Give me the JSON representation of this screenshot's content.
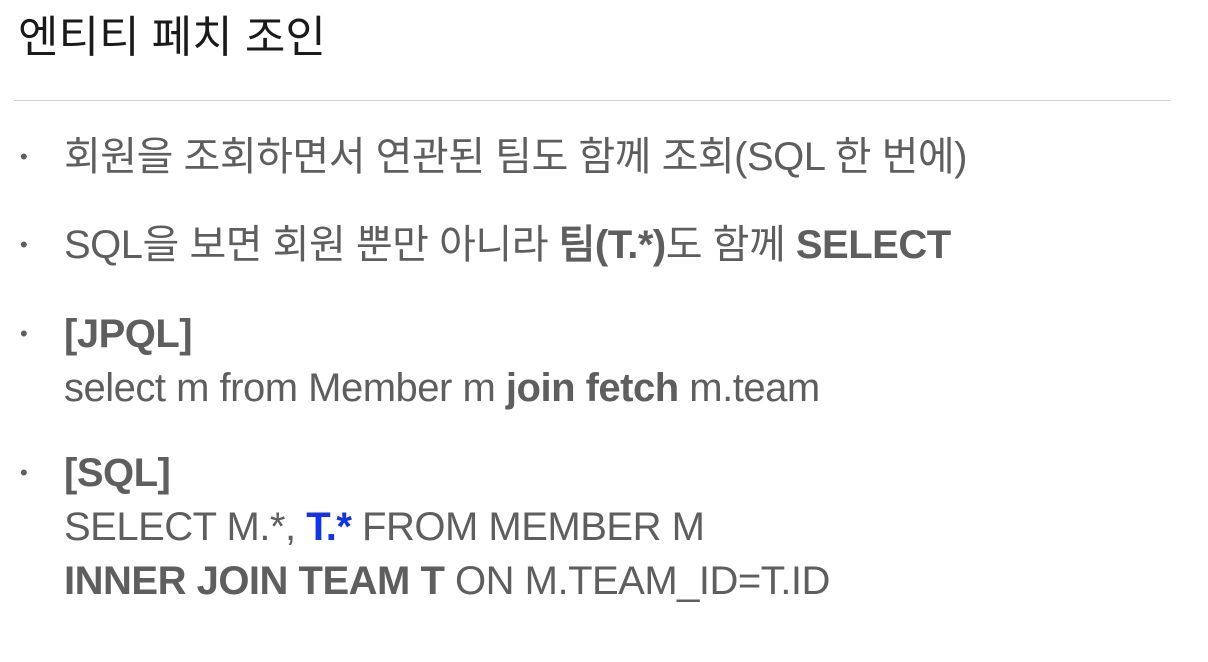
{
  "slide": {
    "title": "엔티티 페치 조인"
  },
  "bullets": {
    "b1": {
      "text": "회원을 조회하면서 연관된 팀도 함께 조회(SQL 한 번에)"
    },
    "b2": {
      "prefix": "SQL을 보면 회원 뿐만 아니라 ",
      "bold1": "팀(T.*)",
      "mid": "도 함께 ",
      "bold2": "SELECT"
    },
    "b3": {
      "heading": "[JPQL]",
      "prefix": "select m from Member m ",
      "bold": "join fetch",
      "suffix": " m.team"
    },
    "b4": {
      "heading": "[SQL]",
      "line1_prefix": "SELECT M.*, ",
      "line1_highlight": "T.*",
      "line1_suffix": " FROM MEMBER M",
      "line2_bold": "INNER JOIN TEAM T",
      "line2_suffix": " ON M.TEAM_ID=T.ID"
    }
  },
  "bullet_char": "•",
  "colors": {
    "text": "#5e5e5e",
    "title": "#1a1a1a",
    "highlight": "#1133ee",
    "rule": "#cfcfcf"
  }
}
